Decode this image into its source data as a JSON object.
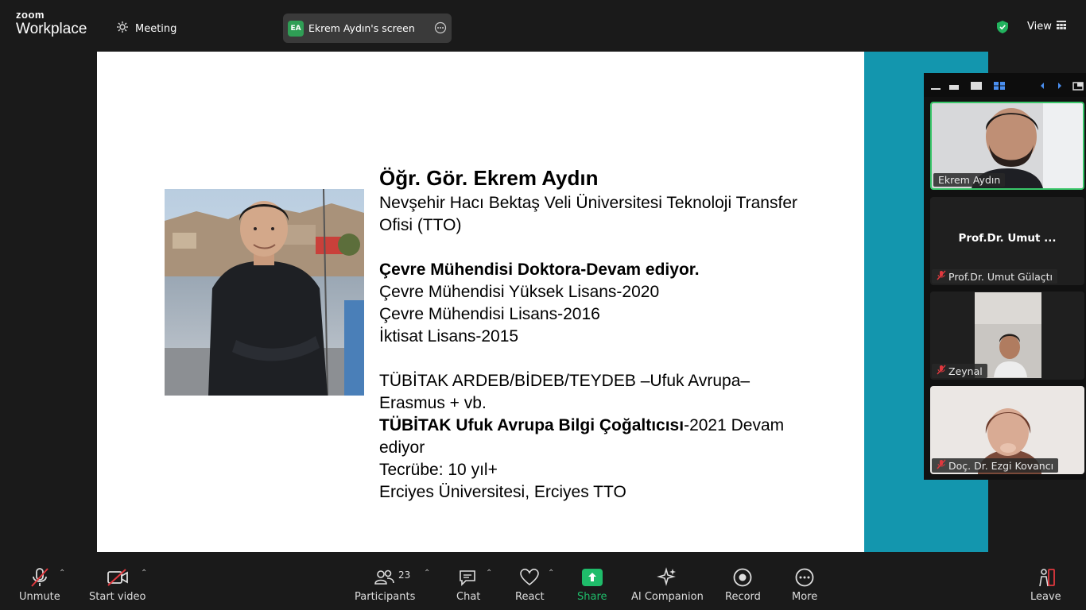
{
  "app": {
    "logo_top": "zoom",
    "logo_bottom": "Workplace"
  },
  "topbar": {
    "meeting_label": "Meeting",
    "screen_badge": "EA",
    "screen_label": "Ekrem Aydın's screen",
    "view_label": "View"
  },
  "slide": {
    "name": "Öğr. Gör. Ekrem Aydın",
    "affiliation_line1": "Nevşehir Hacı Bektaş Veli Üniversitesi Teknoloji Transfer",
    "affiliation_line2": "Ofisi (TTO)",
    "edu_bold": "Çevre Mühendisi Doktora-Devam ediyor.",
    "edu_1": "Çevre Mühendisi Yüksek Lisans-2020",
    "edu_2": "Çevre Mühendisi Lisans-2016",
    "edu_3": "İktisat Lisans-2015",
    "tubitak_line1": "TÜBİTAK ARDEB/BİDEB/TEYDEB –Ufuk Avrupa–",
    "tubitak_line2": "Erasmus + vb.",
    "ufuk_bold": "TÜBİTAK Ufuk Avrupa Bilgi Çoğaltıcısı",
    "ufuk_rest": "-2021 Devam",
    "ufuk_line2": "ediyor",
    "experience": "Tecrübe: 10 yıl+",
    "org": "Erciyes Üniversitesi, Erciyes TTO"
  },
  "participants_panel": {
    "tiles": [
      {
        "name": "Ekrem Aydın"
      },
      {
        "display": "Prof.Dr. Umut ...",
        "name": "Prof.Dr. Umut Gülaçtı"
      },
      {
        "name": "Zeynal"
      },
      {
        "name": "Doç. Dr. Ezgi Kovancı"
      }
    ]
  },
  "toolbar": {
    "unmute": "Unmute",
    "start_video": "Start video",
    "participants": "Participants",
    "participants_count": "23",
    "chat": "Chat",
    "react": "React",
    "share": "Share",
    "ai_companion": "AI Companion",
    "record": "Record",
    "more": "More",
    "leave": "Leave"
  },
  "colors": {
    "accent_green": "#1fbc6a",
    "slide_band": "#1396ae",
    "mute_red": "#e0383e"
  }
}
